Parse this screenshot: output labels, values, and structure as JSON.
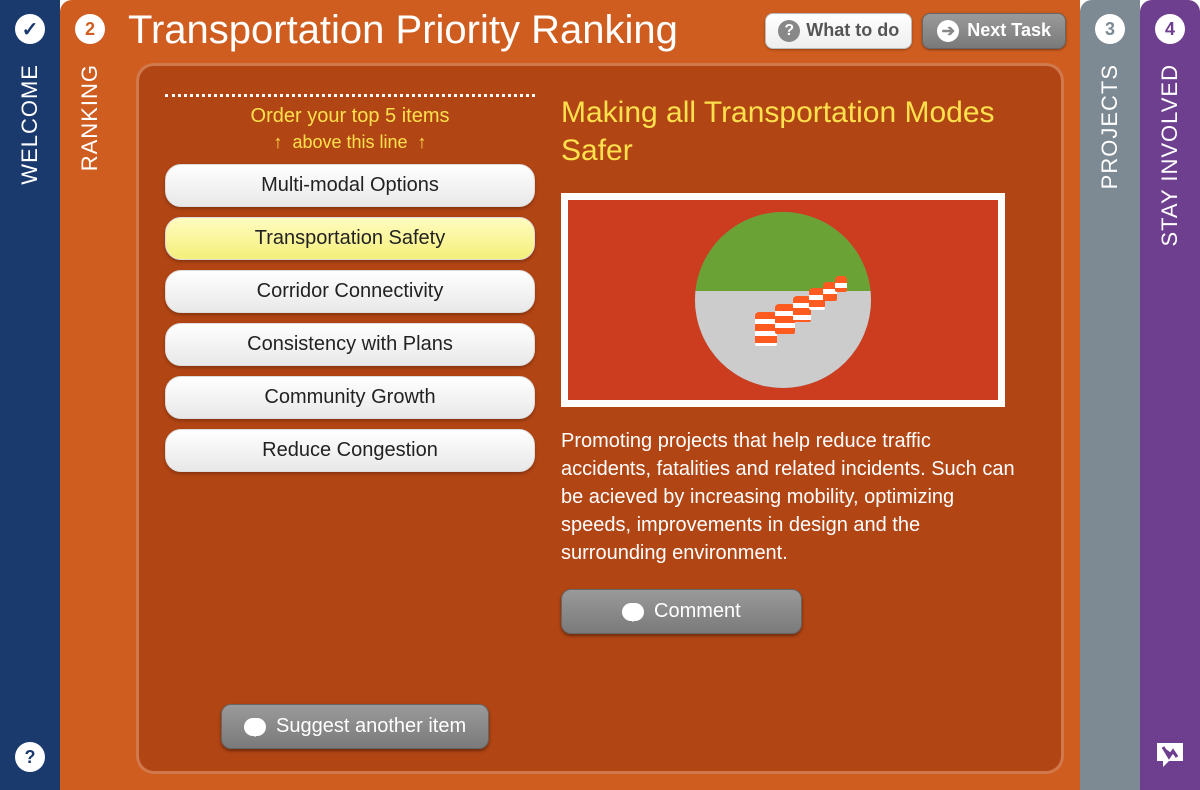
{
  "tabs": {
    "welcome": {
      "label": "WELCOME"
    },
    "ranking": {
      "badge": "2",
      "label": "RANKING"
    },
    "projects": {
      "badge": "3",
      "label": "PROJECTS"
    },
    "stay": {
      "badge": "4",
      "label": "STAY INVOLVED"
    }
  },
  "header": {
    "title": "Transportation Priority Ranking",
    "what_to_do": "What to do",
    "next_task": "Next Task"
  },
  "ranking_panel": {
    "hint_line1": "Order your top 5 items",
    "hint_line2": "above this line",
    "items": [
      {
        "label": "Multi-modal Options",
        "selected": false
      },
      {
        "label": "Transportation Safety",
        "selected": true
      },
      {
        "label": "Corridor Connectivity",
        "selected": false
      },
      {
        "label": "Consistency with Plans",
        "selected": false
      },
      {
        "label": "Community Growth",
        "selected": false
      },
      {
        "label": "Reduce Congestion",
        "selected": false
      }
    ],
    "suggest_label": "Suggest another item"
  },
  "detail": {
    "title": "Making all Transportation Modes Safer",
    "description": "Promoting projects that help reduce traffic accidents, fatalities and related incidents. Such can be acieved by increasing mobility, optimizing speeds, improvements in design and the surrounding environment.",
    "comment_label": "Comment"
  }
}
